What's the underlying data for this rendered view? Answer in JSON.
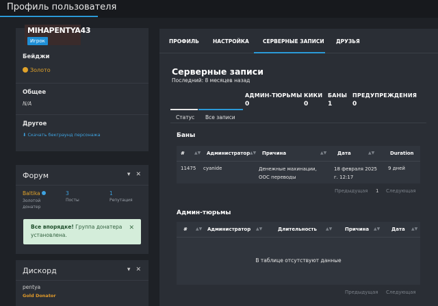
{
  "header": {
    "title": "Профиль пользователя"
  },
  "profile": {
    "username": "MIHAPENTYA43",
    "role": "Игрок",
    "badges_title": "Бейджи",
    "badge_gold": "Золото",
    "general_title": "Общее",
    "general_value": "N/A",
    "other_title": "Другое",
    "download_link": "Скачать бекграунд персонажа"
  },
  "forum": {
    "title": "Форум",
    "user": "Baltika",
    "user_role_line1": "Золотой",
    "user_role_line2": "донатер",
    "posts_value": "3",
    "posts_label": "Посты",
    "rep_value": "1",
    "rep_label": "Репутация",
    "alert_bold": "Все впорядке!",
    "alert_text": "Группа донатера установлена."
  },
  "discord": {
    "title": "Дискорд",
    "user": "pentya",
    "role": "Gold Donator"
  },
  "tabs": [
    "ПРОФИЛЬ",
    "НАСТРОЙКА",
    "СЕРВЕРНЫЕ ЗАПИСИ",
    "ДРУЗЬЯ"
  ],
  "records": {
    "title": "Серверные записи",
    "last": "Последний: 8 месяцев назад",
    "counters": [
      {
        "label": "АДМИН-ТЮРЬМЫ",
        "value": "0"
      },
      {
        "label": "КИКИ",
        "value": "0"
      },
      {
        "label": "БАНЫ",
        "value": "1"
      },
      {
        "label": "ПРЕДУПРЕЖДЕНИЯ",
        "value": "0"
      }
    ],
    "subtabs": [
      "Статус",
      "Все записи"
    ],
    "bans": {
      "title": "Баны",
      "columns": [
        "#",
        "Администратор",
        "Причина",
        "Дата",
        "Duration"
      ],
      "row": {
        "id": "11475",
        "admin": "cyanide",
        "reason_1": "Денежные махинации,",
        "reason_2": "ООС переводы",
        "date_1": "18 февраля 2025",
        "date_2": "г. 12:17",
        "duration": "9 дней"
      },
      "pager_prev": "Предыдущая",
      "pager_page": "1",
      "pager_next": "Следующая"
    },
    "jails": {
      "title": "Админ-тюрьмы",
      "columns": [
        "#",
        "Администратор",
        "Длительность",
        "Причина",
        "Дата"
      ],
      "empty": "В таблице отсутствуют данные",
      "pager_prev": "Предыдущая",
      "pager_next": "Следующая"
    }
  }
}
